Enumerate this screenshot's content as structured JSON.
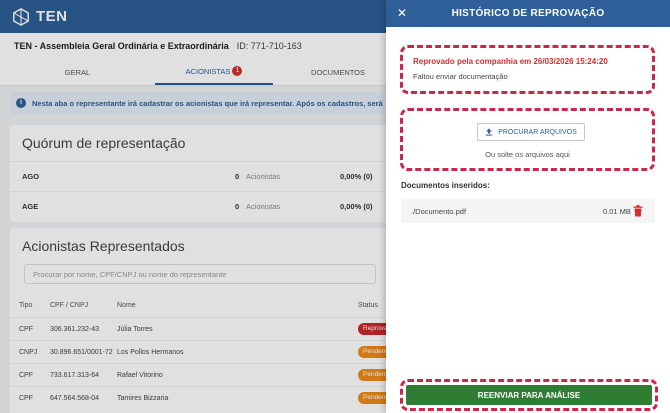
{
  "app": {
    "logo_text": "TEN"
  },
  "assembly": {
    "title": "TEN - Assembleia Geral Ordinária e Extraordinária",
    "id_text": "ID: 771-710-163"
  },
  "tabs": [
    {
      "label": "GERAL"
    },
    {
      "label": "ACIONISTAS",
      "badge": "1"
    },
    {
      "label": "DOCUMENTOS"
    }
  ],
  "info_banner": "Nesta aba o representante irá cadastrar os acionistas que irá representar. Após os cadastros, será",
  "quorum": {
    "title": "Quórum de representação",
    "rows": [
      {
        "label": "AGO",
        "count": "0",
        "word": "Acionistas",
        "pct": "0,00% (0)"
      },
      {
        "label": "AGE",
        "count": "0",
        "word": "Acionistas",
        "pct": "0,00% (0)"
      }
    ]
  },
  "reps": {
    "title": "Acionistas Representados",
    "search_placeholder": "Procurar por nome, CPF/CNPJ ou nome do representante",
    "headers": {
      "type": "Tipo",
      "doc": "CPF / CNPJ",
      "name": "Nome",
      "status": "Status"
    },
    "rows": [
      {
        "type": "CPF",
        "doc": "306.361.232-43",
        "name": "Júlia Torres",
        "status": "Reprovado",
        "status_color": "#c62828"
      },
      {
        "type": "CNPJ",
        "doc": "30.896.651/0001-72",
        "name": "Los Pollos Hermanos",
        "status": "Pendente",
        "status_color": "#ef8a17"
      },
      {
        "type": "CPF",
        "doc": "733.617.313-64",
        "name": "Rafael Vitorino",
        "status": "Pendente",
        "status_color": "#ef8a17"
      },
      {
        "type": "CPF",
        "doc": "647.564.568-04",
        "name": "Tamires Bizzaria",
        "status": "Pendente",
        "status_color": "#ef8a17"
      }
    ]
  },
  "drawer": {
    "title": "HISTÓRICO DE REPROVAÇÃO",
    "close_icon": "close-icon",
    "rejection": {
      "title": "Reprovado pela companhia em 26/03/2026 15:24:20",
      "reason": "Faltou enviar documentação"
    },
    "upload": {
      "button_label": "PROCURAR ARQUIVOS",
      "drop_text": "Ou solte os arquivos aqui"
    },
    "docs_label": "Documentos inseridos:",
    "documents": [
      {
        "name": "./Documento.pdf",
        "size": "0.01 MB"
      }
    ],
    "submit_label": "REENVIAR PARA ANÁLISE"
  },
  "colors": {
    "brand": "#2e5f98",
    "highlight": "#c9284b",
    "danger": "#d32f2f",
    "success": "#2e7d32",
    "pending": "#ef8a17"
  }
}
